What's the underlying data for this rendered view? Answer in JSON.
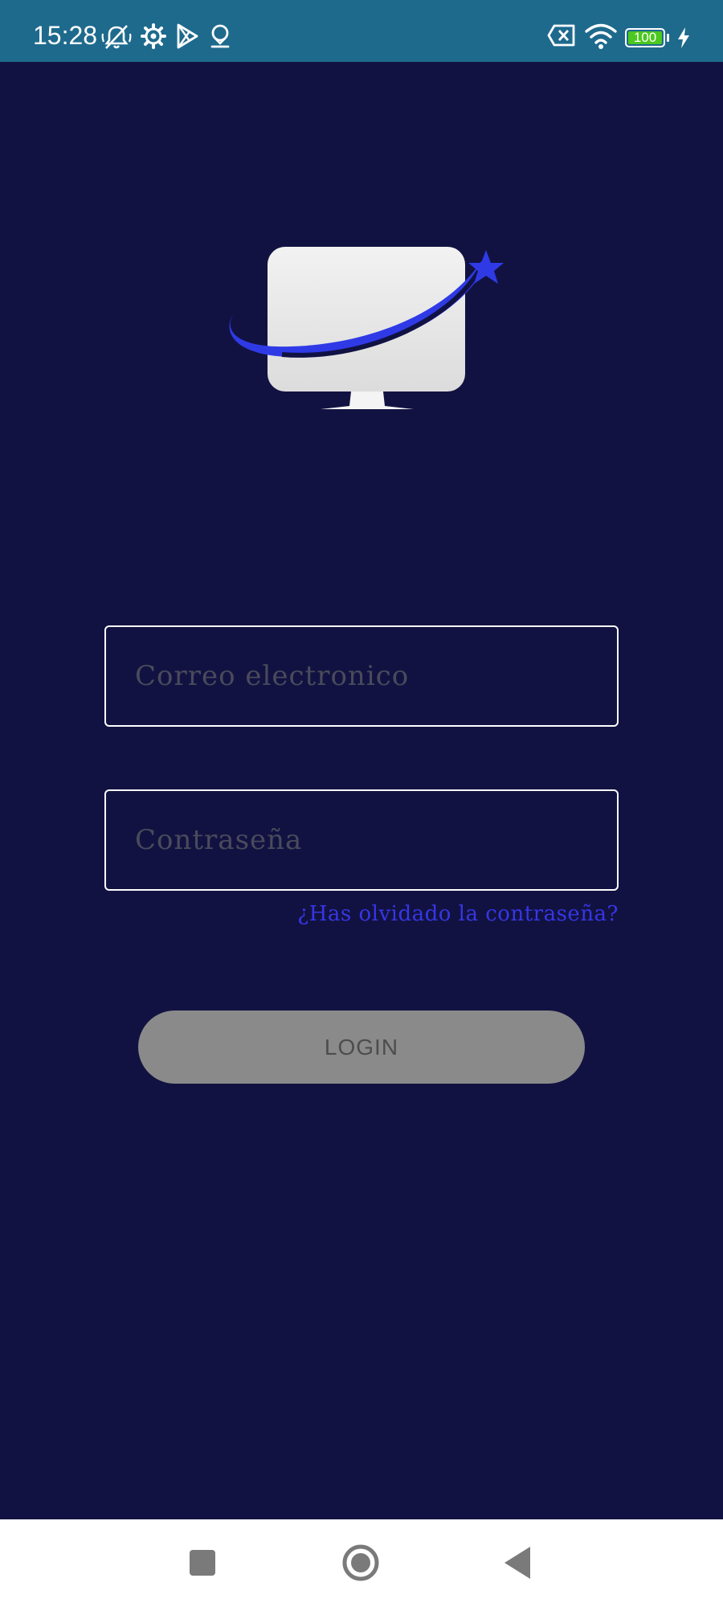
{
  "status_bar": {
    "time": "15:28",
    "left_icons": [
      "mute-icon",
      "settings-icon",
      "play-store-icon",
      "location-icon"
    ],
    "right_icons": [
      "no-sim-icon",
      "wifi-icon",
      "battery-icon",
      "charging-icon"
    ],
    "battery_level": "100",
    "battery_fraction": 1.0,
    "background_color": "#1e6a8d"
  },
  "logo": {
    "icon": "tv-logo-icon",
    "accent_color": "#2f3ae6"
  },
  "form": {
    "email_placeholder": "Correo electronico",
    "email_value": "",
    "password_placeholder": "Contraseña",
    "password_value": "",
    "forgot_link": "¿Has olvidado la contraseña?",
    "login_label": "LOGIN"
  },
  "nav_bar": {
    "icons": [
      "recents-icon",
      "home-icon",
      "back-icon"
    ]
  },
  "colors": {
    "background": "#121242",
    "link": "#3636e6",
    "button_disabled": "#8a8a8a"
  }
}
